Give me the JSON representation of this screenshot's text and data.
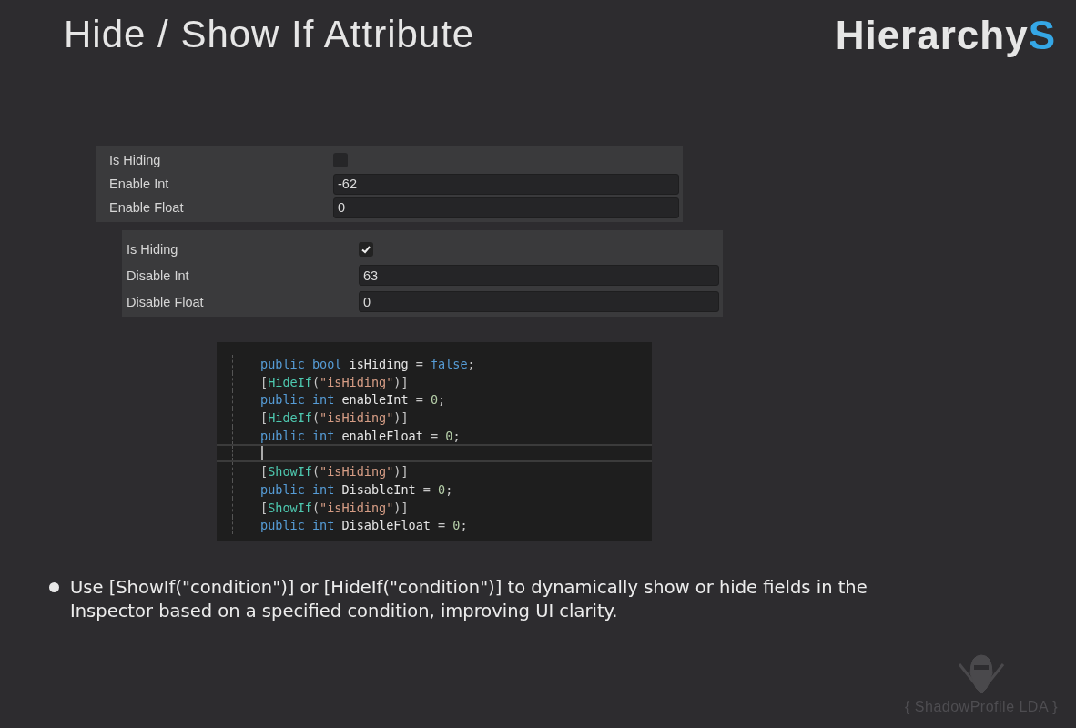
{
  "title": "Hide / Show If Attribute",
  "logo": {
    "text": "Hierarchy",
    "accent": "S"
  },
  "panels": [
    {
      "rows": [
        {
          "kind": "checkbox",
          "label": "Is Hiding",
          "checked": false
        },
        {
          "kind": "field",
          "label": "Enable Int",
          "value": "-62"
        },
        {
          "kind": "field",
          "label": "Enable Float",
          "value": "0"
        }
      ]
    },
    {
      "rows": [
        {
          "kind": "checkbox",
          "label": "Is Hiding",
          "checked": true
        },
        {
          "kind": "field",
          "label": "Disable Int",
          "value": "63"
        },
        {
          "kind": "field",
          "label": "Disable Float",
          "value": "0"
        }
      ]
    }
  ],
  "code": {
    "lines": [
      {
        "cursor": false,
        "tokens": [
          {
            "kind": "kw",
            "t": "public"
          },
          {
            "kind": "kw",
            "t": " bool"
          },
          {
            "kind": "id",
            "t": " isHiding"
          },
          {
            "kind": "op",
            "t": " = "
          },
          {
            "kind": "kw",
            "t": "false"
          },
          {
            "kind": "op",
            "t": ";"
          }
        ]
      },
      {
        "cursor": false,
        "tokens": [
          {
            "kind": "op",
            "t": "["
          },
          {
            "kind": "attr",
            "t": "HideIf"
          },
          {
            "kind": "op",
            "t": "("
          },
          {
            "kind": "str",
            "t": "\"isHiding\""
          },
          {
            "kind": "op",
            "t": ")]"
          }
        ]
      },
      {
        "cursor": false,
        "tokens": [
          {
            "kind": "kw",
            "t": "public"
          },
          {
            "kind": "kw",
            "t": " int"
          },
          {
            "kind": "id",
            "t": " enableInt"
          },
          {
            "kind": "op",
            "t": " = "
          },
          {
            "kind": "num",
            "t": "0"
          },
          {
            "kind": "op",
            "t": ";"
          }
        ]
      },
      {
        "cursor": false,
        "tokens": [
          {
            "kind": "op",
            "t": "["
          },
          {
            "kind": "attr",
            "t": "HideIf"
          },
          {
            "kind": "op",
            "t": "("
          },
          {
            "kind": "str",
            "t": "\"isHiding\""
          },
          {
            "kind": "op",
            "t": ")]"
          }
        ]
      },
      {
        "cursor": false,
        "tokens": [
          {
            "kind": "kw",
            "t": "public"
          },
          {
            "kind": "kw",
            "t": " int"
          },
          {
            "kind": "id",
            "t": " enableFloat"
          },
          {
            "kind": "op",
            "t": " = "
          },
          {
            "kind": "num",
            "t": "0"
          },
          {
            "kind": "op",
            "t": ";"
          }
        ]
      },
      {
        "cursor": true
      },
      {
        "cursor": false,
        "tokens": [
          {
            "kind": "op",
            "t": "["
          },
          {
            "kind": "attr",
            "t": "ShowIf"
          },
          {
            "kind": "op",
            "t": "("
          },
          {
            "kind": "str",
            "t": "\"isHiding\""
          },
          {
            "kind": "op",
            "t": ")]"
          }
        ]
      },
      {
        "cursor": false,
        "tokens": [
          {
            "kind": "kw",
            "t": "public"
          },
          {
            "kind": "kw",
            "t": " int"
          },
          {
            "kind": "id",
            "t": " DisableInt"
          },
          {
            "kind": "op",
            "t": " = "
          },
          {
            "kind": "num",
            "t": "0"
          },
          {
            "kind": "op",
            "t": ";"
          }
        ]
      },
      {
        "cursor": false,
        "tokens": [
          {
            "kind": "op",
            "t": "["
          },
          {
            "kind": "attr",
            "t": "ShowIf"
          },
          {
            "kind": "op",
            "t": "("
          },
          {
            "kind": "str",
            "t": "\"isHiding\""
          },
          {
            "kind": "op",
            "t": ")]"
          }
        ]
      },
      {
        "cursor": false,
        "tokens": [
          {
            "kind": "kw",
            "t": "public"
          },
          {
            "kind": "kw",
            "t": " int"
          },
          {
            "kind": "id",
            "t": " DisableFloat"
          },
          {
            "kind": "op",
            "t": " = "
          },
          {
            "kind": "num",
            "t": "0"
          },
          {
            "kind": "op",
            "t": ";"
          }
        ]
      }
    ]
  },
  "bullets": [
    "Use [ShowIf(\"condition\")] or [HideIf(\"condition\")] to dynamically show or hide fields in the Inspector based on a specified condition, improving UI clarity."
  ],
  "credit": "{ ShadowProfile LDA }"
}
